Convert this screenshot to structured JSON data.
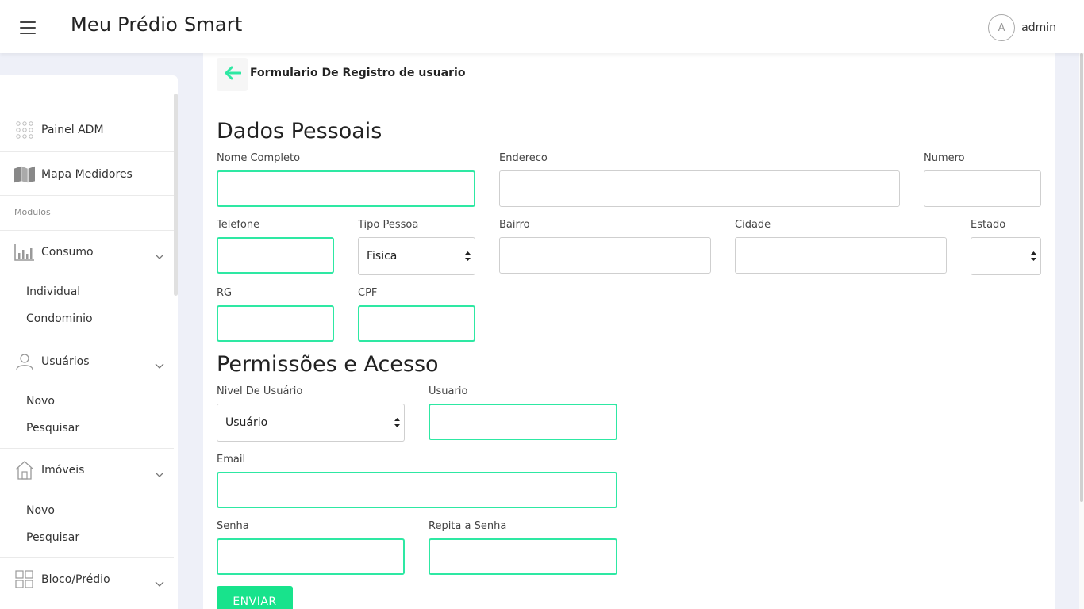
{
  "app": {
    "title": "Meu Prédio Smart"
  },
  "user": {
    "avatar_letter": "A",
    "name": "admin"
  },
  "sidebar": {
    "painel": "Painel ADM",
    "mapa": "Mapa Medidores",
    "section_label": "Modulos",
    "consumo": {
      "label": "Consumo",
      "items": [
        "Individual",
        "Condominio"
      ]
    },
    "usuarios": {
      "label": "Usuários",
      "items": [
        "Novo",
        "Pesquisar"
      ]
    },
    "imoveis": {
      "label": "Imóveis",
      "items": [
        "Novo",
        "Pesquisar"
      ]
    },
    "bloco": {
      "label": "Bloco/Prédio"
    }
  },
  "form": {
    "title": "Formulario De Registro de usuario",
    "dados_title": "Dados Pessoais",
    "permissoes_title": "Permissões e Acesso",
    "fields": {
      "nome": {
        "label": "Nome Completo",
        "value": ""
      },
      "endereco": {
        "label": "Endereco",
        "value": ""
      },
      "numero": {
        "label": "Numero",
        "value": ""
      },
      "telefone": {
        "label": "Telefone",
        "value": ""
      },
      "tipo_pessoa": {
        "label": "Tipo Pessoa",
        "value": "Fisica"
      },
      "bairro": {
        "label": "Bairro",
        "value": ""
      },
      "cidade": {
        "label": "Cidade",
        "value": ""
      },
      "estado": {
        "label": "Estado",
        "value": ""
      },
      "rg": {
        "label": "RG",
        "value": ""
      },
      "cpf": {
        "label": "CPF",
        "value": ""
      },
      "nivel": {
        "label": "Nivel De Usuário",
        "value": "Usuário"
      },
      "usuario": {
        "label": "Usuario",
        "value": ""
      },
      "email": {
        "label": "Email",
        "value": ""
      },
      "senha": {
        "label": "Senha",
        "value": ""
      },
      "repita_senha": {
        "label": "Repita a Senha",
        "value": ""
      }
    },
    "submit_label": "ENVIAR"
  },
  "colors": {
    "accent": "#2ee8a3",
    "button": "#18e38c",
    "background": "#eef0f8"
  }
}
